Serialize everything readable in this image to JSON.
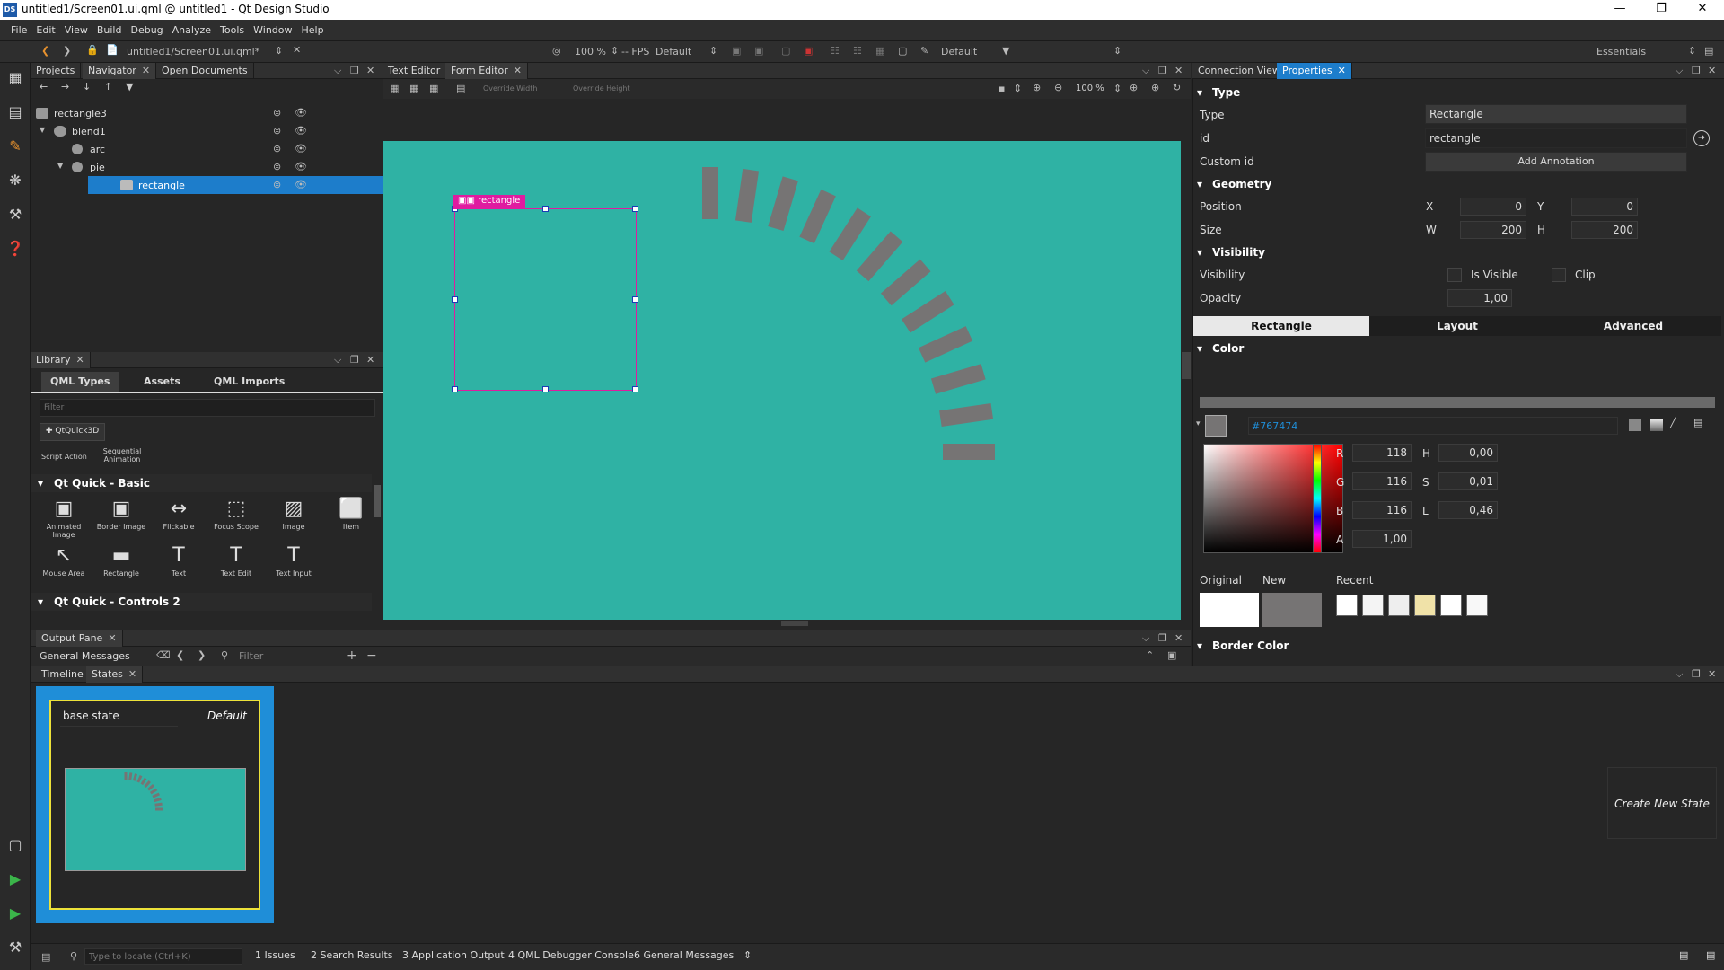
{
  "window": {
    "title": "untitled1/Screen01.ui.qml @ untitled1 - Qt Design Studio",
    "logo": "DS"
  },
  "menu": [
    "File",
    "Edit",
    "View",
    "Build",
    "Debug",
    "Analyze",
    "Tools",
    "Window",
    "Help"
  ],
  "toolbar": {
    "file": "untitled1/Screen01.ui.qml*",
    "zoom": "100 %",
    "fps": "-- FPS",
    "fps_mode": "Default",
    "theme": "Default",
    "workspace": "Essentials"
  },
  "navigator": {
    "tabs": [
      "Projects",
      "Navigator",
      "Open Documents"
    ],
    "items": [
      {
        "label": "rectangle3"
      },
      {
        "label": "blend1"
      },
      {
        "label": "arc"
      },
      {
        "label": "pie"
      },
      {
        "label": "rectangle"
      }
    ]
  },
  "library": {
    "tab_title": "Library",
    "tabs": [
      "QML Types",
      "Assets",
      "QML Imports"
    ],
    "filter_placeholder": "Filter",
    "add_module": "QtQuick3D",
    "top_items": [
      "Script Action",
      "Sequential Animation"
    ],
    "section1": "Qt Quick - Basic",
    "basic": [
      {
        "label": "Animated Image",
        "icon": "animated-image-icon"
      },
      {
        "label": "Border Image",
        "icon": "border-image-icon"
      },
      {
        "label": "Flickable",
        "icon": "flickable-icon"
      },
      {
        "label": "Focus Scope",
        "icon": "focus-scope-icon"
      },
      {
        "label": "Image",
        "icon": "image-icon"
      },
      {
        "label": "Item",
        "icon": "item-icon"
      },
      {
        "label": "Mouse Area",
        "icon": "mouse-area-icon"
      },
      {
        "label": "Rectangle",
        "icon": "rectangle-icon"
      },
      {
        "label": "Text",
        "icon": "text-icon"
      },
      {
        "label": "Text Edit",
        "icon": "text-edit-icon"
      },
      {
        "label": "Text Input",
        "icon": "text-input-icon"
      }
    ],
    "section2": "Qt Quick - Controls 2"
  },
  "editor": {
    "tabs": [
      "Text Editor",
      "Form Editor"
    ],
    "override_width": "Override Width",
    "override_height": "Override Height",
    "zoom": "100 %",
    "selection_label": "rectangle",
    "canvas_color": "#2fb2a4",
    "bar_color": "#767474",
    "arc_bars": 12
  },
  "output": {
    "title": "Output Pane",
    "general": "General Messages",
    "filter": "Filter"
  },
  "states": {
    "tabs": [
      "Timeline",
      "States"
    ],
    "base_state": "base state",
    "default_label": "Default",
    "create_button": "Create New State"
  },
  "properties": {
    "tabs": [
      "Connection View",
      "Properties"
    ],
    "type_section": "Type",
    "type_label": "Type",
    "type_value": "Rectangle",
    "id_label": "id",
    "id_value": "rectangle",
    "custom_id_label": "Custom id",
    "add_annotation": "Add Annotation",
    "geometry_section": "Geometry",
    "position_label": "Position",
    "x_label": "X",
    "x_value": "0",
    "y_label": "Y",
    "y_value": "0",
    "size_label": "Size",
    "w_label": "W",
    "w_value": "200",
    "h_label": "H",
    "h_value": "200",
    "visibility_section": "Visibility",
    "visibility_label": "Visibility",
    "is_visible": "Is Visible",
    "clip": "Clip",
    "opacity_label": "Opacity",
    "opacity_value": "1,00",
    "sub_tabs": [
      "Rectangle",
      "Layout",
      "Advanced"
    ],
    "color_section": "Color",
    "hex": "#767474",
    "r_label": "R",
    "r_value": "118",
    "h2_label": "H",
    "h2_value": "0,00",
    "g_label": "G",
    "g_value": "116",
    "s_label": "S",
    "s_value": "0,01",
    "b_label": "B",
    "b_value": "116",
    "l_label": "L",
    "l_value": "0,46",
    "a_label": "A",
    "a_value": "1,00",
    "original_label": "Original",
    "new_label": "New",
    "recent_label": "Recent",
    "recent_colors": [
      "#ffffff",
      "#f4f4f4",
      "#eeeeee",
      "#f0e2a8",
      "#ffffff",
      "#f8f8f8"
    ],
    "border_section": "Border Color"
  },
  "statusbar": {
    "locate_placeholder": "Type to locate (Ctrl+K)",
    "items": [
      "1  Issues",
      "2  Search Results",
      "3  Application Output",
      "4  QML Debugger Console",
      "6  General Messages"
    ]
  }
}
